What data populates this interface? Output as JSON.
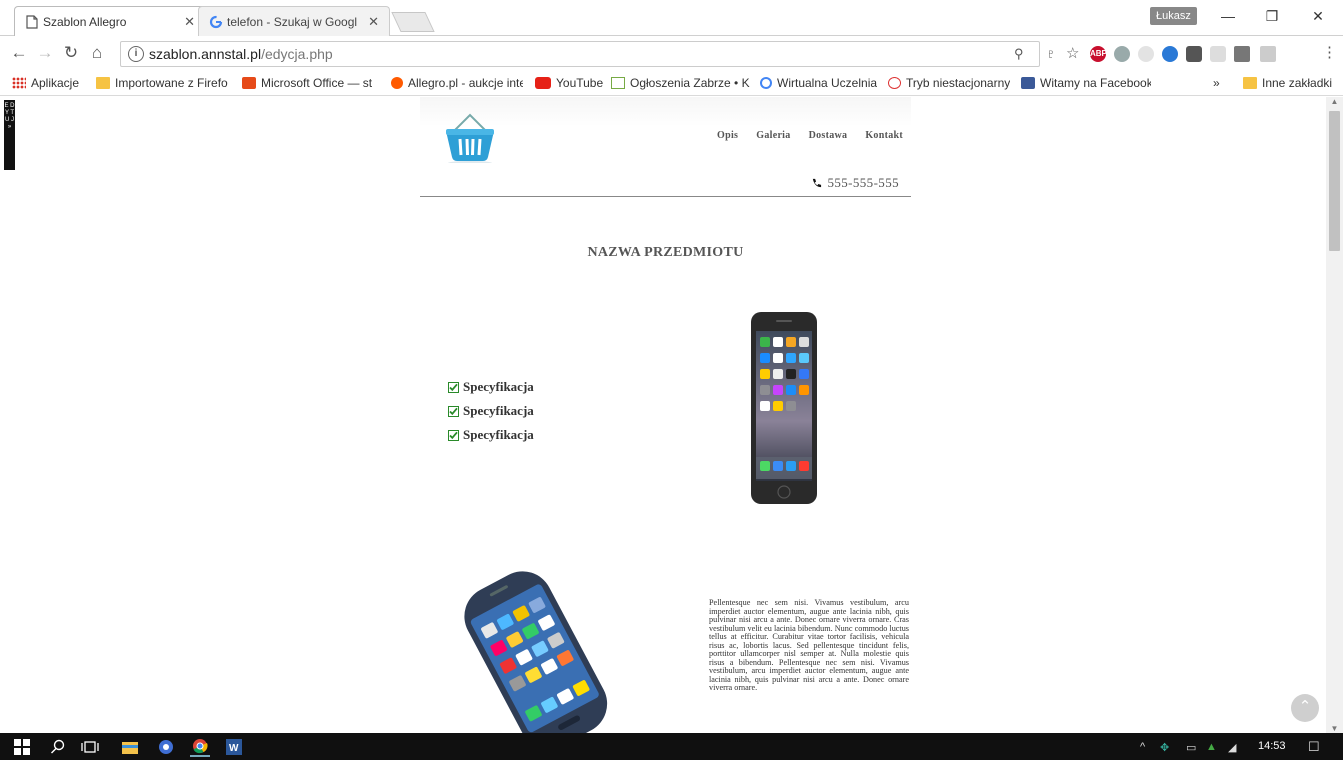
{
  "browser": {
    "tabs": [
      {
        "title": "Szablon Allegro",
        "active": true
      },
      {
        "title": "telefon - Szukaj w Googl",
        "active": false
      }
    ],
    "user_name": "Łukasz",
    "url_host": "szablon.annstal.pl",
    "url_path": "/edycja.php",
    "bookmarks": [
      {
        "label": "Aplikacje",
        "icon": "apps-grid-icon"
      },
      {
        "label": "Importowane z Firefo",
        "icon": "folder-icon"
      },
      {
        "label": "Microsoft Office — st",
        "icon": "office-icon"
      },
      {
        "label": "Allegro.pl - aukcje inte",
        "icon": "allegro-icon"
      },
      {
        "label": "YouTube",
        "icon": "youtube-icon"
      },
      {
        "label": "Ogłoszenia Zabrze • K",
        "icon": "olx-icon"
      },
      {
        "label": "Wirtualna Uczelnia",
        "icon": "google-icon"
      },
      {
        "label": "Tryb niestacjonarny",
        "icon": "red-circle-icon"
      },
      {
        "label": "Witamy na Facebooku",
        "icon": "facebook-icon"
      }
    ],
    "bookmarks_overflow": "»",
    "other_bookmarks": "Inne zakładki"
  },
  "edit_strip_label": "E D Y T U J »",
  "page": {
    "nav": [
      "Opis",
      "Galeria",
      "Dostawa",
      "Kontakt"
    ],
    "phone": "555-555-555",
    "item_title": "NAZWA PRZEDMIOTU",
    "specs": [
      "Specyfikacja",
      "Specyfikacja",
      "Specyfikacja"
    ],
    "description": "Pellentesque nec sem nisi. Vivamus vestibulum, arcu imperdiet auctor elementum, augue ante lacinia nibh, quis pulvinar nisi arcu a ante. Donec ornare viverra ornare. Cras vestibulum velit eu lacinia bibendum. Nunc commodo luctus tellus at efficitur. Curabitur vitae tortor facilisis, vehicula risus ac, lobortis lacus. Sed pellentesque tincidunt felis, porttitor ullamcorper nisl semper at. Nulla molestie quis risus a bibendum. Pellentesque nec sem nisi. Vivamus vestibulum, arcu imperdiet auctor elementum, augue ante lacinia nibh, quis pulvinar nisi arcu a ante. Donec ornare viverra ornare."
  },
  "taskbar": {
    "clock": "14:53"
  },
  "colors": {
    "basket_blue": "#2e9fd6",
    "checkbox_green": "#2a8a2a",
    "taskbar_bg": "#101010"
  }
}
